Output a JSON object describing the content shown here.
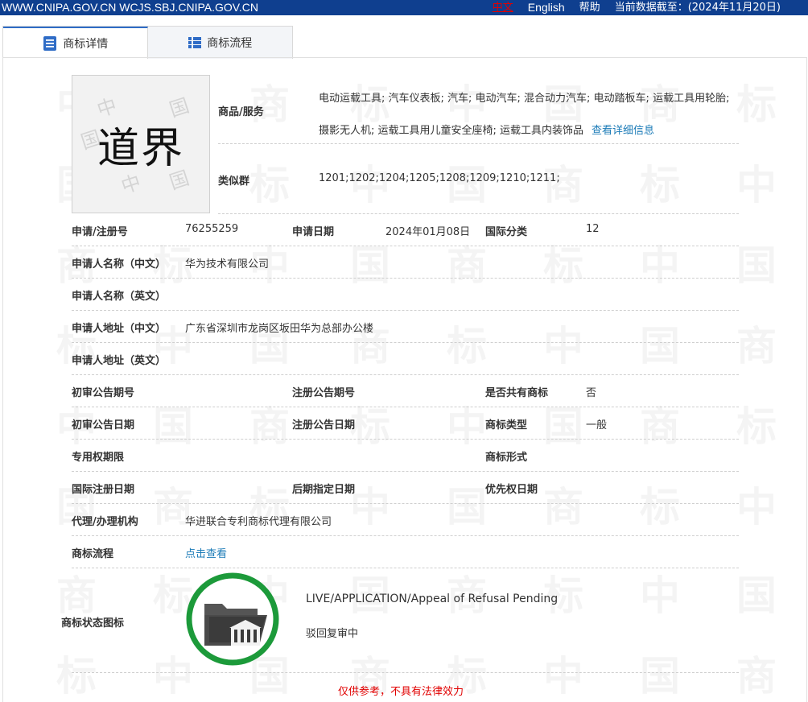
{
  "topbar": {
    "sites": "WWW.CNIPA.GOV.CN  WCJS.SBJ.CNIPA.GOV.CN",
    "lang_cn": "中文",
    "lang_en": "English",
    "help": "帮助",
    "data_date": "当前数据截至：(2024年11月20日)"
  },
  "tabs": [
    {
      "label": "商标详情",
      "icon": "document-icon"
    },
    {
      "label": "商标流程",
      "icon": "list-icon"
    }
  ],
  "trademark": {
    "mark_text": "道界",
    "goods_label": "商品/服务",
    "goods_text": "电动运载工具; 汽车仪表板; 汽车; 电动汽车; 混合动力汽车; 电动踏板车; 运载工具用轮胎; 摄影无人机; 运载工具用儿童安全座椅; 运载工具内装饰品",
    "goods_link": "查看详细信息",
    "similar_label": "类似群",
    "similar_value": "1201;1202;1204;1205;1208;1209;1210;1211;"
  },
  "fields": {
    "reg_no_label": "申请/注册号",
    "reg_no": "76255259",
    "app_date_label": "申请日期",
    "app_date": "2024年01月08日",
    "intl_class_label": "国际分类",
    "intl_class": "12",
    "applicant_cn_label": "申请人名称（中文）",
    "applicant_cn": "华为技术有限公司",
    "applicant_en_label": "申请人名称（英文）",
    "applicant_en": "",
    "address_cn_label": "申请人地址（中文）",
    "address_cn": "广东省深圳市龙岗区坂田华为总部办公楼",
    "address_en_label": "申请人地址（英文）",
    "address_en": "",
    "prelim_no_label": "初审公告期号",
    "reg_notice_no_label": "注册公告期号",
    "shared_label": "是否共有商标",
    "shared": "否",
    "prelim_date_label": "初审公告日期",
    "reg_notice_date_label": "注册公告日期",
    "mark_type_label": "商标类型",
    "mark_type": "一般",
    "exclusive_period_label": "专用权期限",
    "mark_form_label": "商标形式",
    "intl_reg_date_label": "国际注册日期",
    "later_designation_label": "后期指定日期",
    "priority_date_label": "优先权日期",
    "agent_label": "代理/办理机构",
    "agent": "华进联合专利商标代理有限公司",
    "flow_label": "商标流程",
    "flow_link": "点击查看",
    "status_icon_label": "商标状态图标",
    "status_en": "LIVE/APPLICATION/Appeal of Refusal Pending",
    "status_cn": "驳回复审中"
  },
  "footer_note": "仅供参考，不具有法律效力",
  "colors": {
    "topbar_bg": "#0f3f8f",
    "link": "#1b7bb7",
    "status_ring": "#1c9a3a",
    "footer_note": "#e10000"
  },
  "watermark": {
    "chars": [
      "中",
      "国",
      "商",
      "标"
    ]
  }
}
